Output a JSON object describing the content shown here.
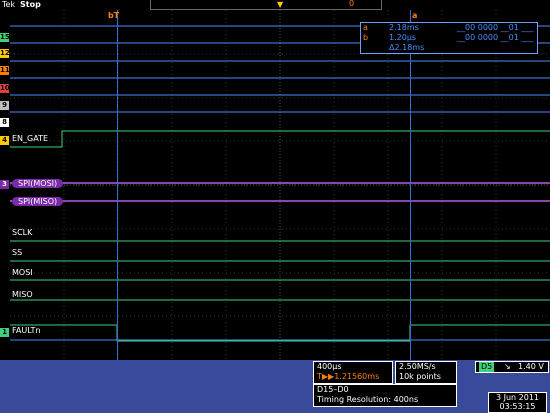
{
  "topbar": {
    "brand": "Tek",
    "status": "Stop",
    "record_marker": "0",
    "trigger_marker": "▼"
  },
  "cursors": {
    "a_tag": "bT",
    "b_tag": "a"
  },
  "readout": {
    "rows": [
      {
        "tag": "a",
        "time": "2.18ms",
        "value": "__00 0000 __01 ___"
      },
      {
        "tag": "b",
        "time": "1.20μs",
        "value": "__00 0000 __01 ___"
      },
      {
        "tag": "Δ",
        "time": "Δ2.18ms",
        "value": ""
      }
    ]
  },
  "channels": [
    {
      "id": "d15",
      "tag": "15",
      "color": "#3fd17a"
    },
    {
      "id": "d12",
      "tag": "12",
      "color": "#ffcc00"
    },
    {
      "id": "d11",
      "tag": "11",
      "color": "#ff8000"
    },
    {
      "id": "d10",
      "tag": "10",
      "color": "#e04040"
    },
    {
      "id": "d9",
      "tag": "9",
      "color": "#c0c0c0"
    },
    {
      "id": "d8",
      "tag": "8",
      "color": "#ffffff"
    },
    {
      "id": "d4",
      "tag": "4",
      "color": "#ffcc00"
    },
    {
      "id": "d3",
      "tag": "3",
      "color": "#7a2aa8"
    },
    {
      "id": "d2",
      "tag": "2",
      "color": "#7a2aa8"
    },
    {
      "id": "d1",
      "tag": "1",
      "color": "#3fd17a"
    }
  ],
  "labels": {
    "en_gate": "EN_GATE",
    "spi_mosi": "SPI(MOSI)",
    "spi_miso": "SPI(MISO)",
    "sclk": "SCLK",
    "ss": "SS",
    "mosi": "MOSI",
    "miso": "MISO",
    "faultn": "FAULTn"
  },
  "bottom": {
    "timebase": "400μs",
    "trigger_pos": "T▶▶1.21560ms",
    "sample_rate": "2.50MS/s",
    "record_length": "10k points",
    "trig_source": "D5",
    "trig_slope": "↘",
    "trig_level": "1.40 V",
    "bus": "D15–D0",
    "resolution": "Timing Resolution: 400ns",
    "date": "3 Jun 2011",
    "time": "03:53:15"
  },
  "colors": {
    "trace": "#3fd17a",
    "bus": "#7a2aa8",
    "cursor": "#3a6ad8",
    "accent": "#ff8000"
  }
}
